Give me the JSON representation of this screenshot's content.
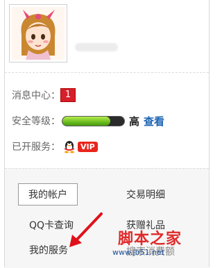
{
  "profile": {
    "avatar_icon": "girl-cartoon-avatar-icon"
  },
  "info": {
    "messages_label": "消息中心：",
    "messages_count": "1",
    "security_label": "安全等级：",
    "security_progress": 0.78,
    "security_level": "高",
    "security_check_link": "查看",
    "services_label": "已开服务：",
    "services_icon": "qq-penguin-icon",
    "vip_badge": "VIP"
  },
  "menu": {
    "my_account": "我的帐户",
    "transactions": "交易明细",
    "qq_card_query": "QQ卡查询",
    "gifts": "获赠礼品",
    "my_services": "我的服务",
    "more": "搜索消费额"
  },
  "watermark": {
    "text": "脚本之家",
    "url": "www.jb51.net"
  },
  "colors": {
    "accent_link": "#1e64b4",
    "badge_red": "#d5202c",
    "progress_green": "#5fb21a"
  }
}
